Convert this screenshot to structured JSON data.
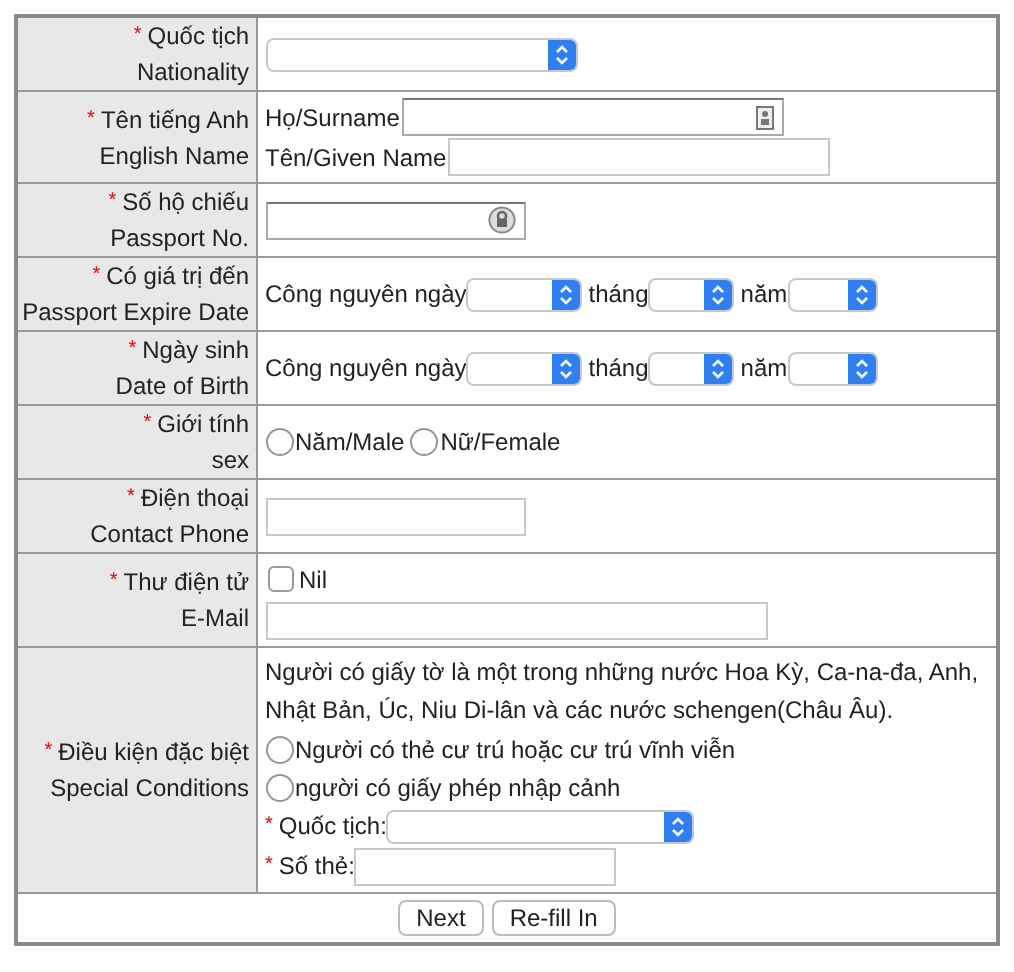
{
  "rows": [
    {
      "mark": "*",
      "label": "Quốc tịch",
      "label_en": "Nationality",
      "kind": "select"
    },
    {
      "mark": "*",
      "label": "Tên tiếng Anh",
      "label_en": "English Name",
      "kind": "name",
      "fields": [
        {
          "label": "Họ/Surname",
          "kind": "card"
        },
        {
          "label": "Tên/Given Name",
          "kind": "plain"
        }
      ]
    },
    {
      "mark": "*",
      "label": "Số hộ chiếu",
      "label_en": "Passport No.",
      "kind": "key_text"
    },
    {
      "mark": "*",
      "label": "Có giá trị đến",
      "label_en": "Passport Expire Date",
      "kind": "date",
      "segments": [
        "Công nguyên ngày",
        "tháng",
        "năm"
      ]
    },
    {
      "mark": "*",
      "label": "Ngày sinh",
      "label_en": "Date of Birth",
      "kind": "date",
      "segments": [
        "Công nguyên ngày",
        "tháng",
        "năm"
      ]
    },
    {
      "mark": "*",
      "label": "Giới tính",
      "label_en": "sex",
      "kind": "radio",
      "options": [
        {
          "label": "Năm/Male",
          "selected": false
        },
        {
          "label": "Nữ/Female",
          "selected": false
        }
      ]
    },
    {
      "mark": "*",
      "label": "Điện thoại",
      "label_en": "Contact Phone",
      "kind": "text"
    },
    {
      "mark": "*",
      "label": "Thư điện tử",
      "label_en": "E-Mail",
      "kind": "email",
      "checkbox": {
        "label": "Nil",
        "checked": false
      }
    },
    {
      "mark": "*",
      "label": "Điều kiện đặc biệt",
      "label_en": "Special Conditions",
      "kind": "special",
      "note": "Người có giấy tờ là một trong những nước Hoa Kỳ, Ca-na-đa, Anh, Nhật Bản, Úc, Niu Di-lân và các nước schengen(Châu Âu).",
      "options": [
        {
          "label": "Người có thẻ cư trú hoặc cư trú vĩnh viễn",
          "selected": false
        },
        {
          "label": "người có giấy phép nhập cảnh",
          "selected": false
        }
      ],
      "subfields": [
        {
          "mark": "*",
          "label": "Quốc tịch:",
          "kind": "select"
        },
        {
          "mark": "*",
          "label": "Số thẻ:",
          "kind": "text"
        }
      ]
    }
  ],
  "buttons": [
    "Next",
    "Re-fill In"
  ]
}
